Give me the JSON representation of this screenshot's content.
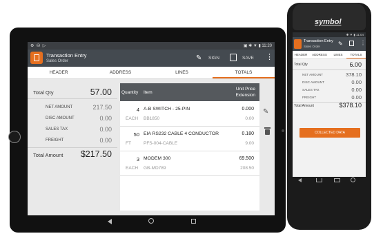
{
  "tablet": {
    "status": {
      "left_icons": "⚙ ⛁ ▷",
      "right_text": "▣ ✱ ▼ ▮ 11:20"
    },
    "app": {
      "title": "Transaction Entry",
      "subtitle": "Sales Order",
      "sign_label": "SIGN",
      "save_label": "SAVE",
      "menu_glyph": "⋮"
    },
    "tabs": [
      "HEADER",
      "ADDRESS",
      "LINES",
      "TOTALS"
    ],
    "totals": {
      "total_qty": {
        "label": "Total Qty",
        "value": "57.00"
      },
      "net_amount": {
        "label": "NET AMOUNT",
        "value": "217.50"
      },
      "disc_amount": {
        "label": "DISC AMOUNT",
        "value": "0.00"
      },
      "sales_tax": {
        "label": "SALES TAX",
        "value": "0.00"
      },
      "freight": {
        "label": "FREIGHT",
        "value": "0.00"
      },
      "total_amount": {
        "label": "Total Amount",
        "value": "$217.50"
      }
    },
    "table": {
      "headers": {
        "quantity": "Quantity",
        "item": "Item",
        "unit_price": "Unit Price",
        "extension": "Extension"
      },
      "rows": [
        {
          "qty": "4",
          "uom": "EACH",
          "desc": "A-B SWITCH - 25-PIN",
          "code": "BB1850",
          "price": "0.000",
          "ext": "0.00"
        },
        {
          "qty": "50",
          "uom": "FT",
          "desc": "EIA RS232 CABLE 4 CONDUCTOR",
          "code": "PFS-004-CABLE",
          "price": "0.180",
          "ext": "9.00"
        },
        {
          "qty": "3",
          "uom": "EACH",
          "desc": "MODEM 300",
          "code": "GB-MD789",
          "price": "69.500",
          "ext": "208.50"
        }
      ]
    },
    "actions": {
      "edit_glyph": "✎"
    },
    "nav": {
      "back": "",
      "home": "",
      "recent": ""
    }
  },
  "phone": {
    "brand": "symbol",
    "status": {
      "right_text": "✱ ▼ ▮ 11:04"
    },
    "app": {
      "title": "Transaction Entry",
      "subtitle": "Sales Order",
      "menu_glyph": "⋮",
      "sign_glyph": "✎"
    },
    "tabs": [
      "HEADER",
      "ADDRESS",
      "LINES",
      "TOTALS"
    ],
    "totals": {
      "total_qty": {
        "label": "Total Qty",
        "value": "6.00"
      },
      "net_amount": {
        "label": "NET AMOUNT",
        "value": "378.10"
      },
      "disc_amount": {
        "label": "DISC AMOUNT",
        "value": "0.00"
      },
      "sales_tax": {
        "label": "SALES TAX",
        "value": "0.00"
      },
      "freight": {
        "label": "FREIGHT",
        "value": "0.00"
      },
      "total_amount": {
        "label": "Total Amount",
        "value": "$378.10"
      }
    },
    "button": {
      "label": "COLLECTED DATA"
    }
  },
  "colors": {
    "accent": "#e56f1f",
    "appbar": "#444a50",
    "table_header": "#55595d"
  }
}
